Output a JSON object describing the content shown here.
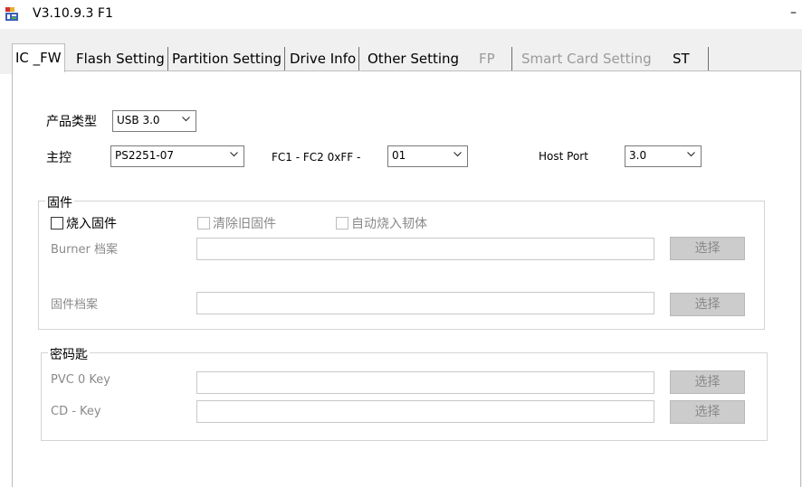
{
  "window": {
    "title": "V3.10.9.3 F1",
    "minimize_label": "–"
  },
  "tabs": [
    {
      "label": "IC _FW",
      "state": "active"
    },
    {
      "label": "Flash Setting",
      "state": "normal"
    },
    {
      "label": "Partition Setting",
      "state": "normal"
    },
    {
      "label": "Drive Info",
      "state": "normal"
    },
    {
      "label": "Other Setting",
      "state": "normal"
    },
    {
      "label": "FP",
      "state": "disabled"
    },
    {
      "label": "Smart Card Setting",
      "state": "disabled"
    },
    {
      "label": "ST",
      "state": "normal"
    }
  ],
  "config": {
    "product_type_label": "产品类型",
    "product_type_value": "USB 3.0",
    "controller_label": "主控",
    "controller_value": "PS2251-07",
    "fc_label": "FC1 - FC2   0xFF -",
    "fc_value": "01",
    "host_port_label": "Host Port",
    "host_port_value": "3.0"
  },
  "firmware": {
    "group_title": "固件",
    "burn_checkbox": "烧入固件",
    "clear_checkbox": "清除旧固件",
    "auto_burn_checkbox": "自动烧入韧体",
    "burner_label": "Burner 档案",
    "burner_path": "",
    "firmware_label": "固件档案",
    "firmware_path": "",
    "select_label": "选择"
  },
  "keys": {
    "group_title": "密码匙",
    "pvc_label": "PVC 0 Key",
    "pvc_value": "",
    "cd_label": "CD - Key",
    "cd_value": "",
    "select_label": "选择"
  },
  "icons": {
    "app": "app-icon",
    "dropdown": "chevron-down-icon"
  }
}
